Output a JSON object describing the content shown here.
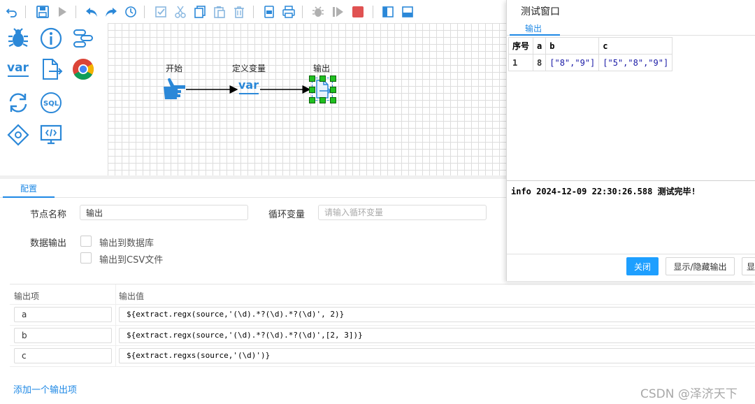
{
  "toolbar": {
    "icons": [
      "undo-icon",
      "save-icon",
      "run-icon",
      "back-icon",
      "forward-icon",
      "history-icon",
      "check-icon",
      "cut-icon",
      "copy-icon",
      "paste-icon",
      "delete-icon",
      "export-icon",
      "print-icon",
      "debug-icon",
      "step-icon",
      "stop-icon",
      "layout-left-icon",
      "layout-bottom-icon"
    ],
    "colors": {
      "icon": "#2b88d8",
      "disabled": "#b0b0b0",
      "stop": "#e05252"
    }
  },
  "palette": {
    "items": [
      "bug-icon",
      "info-icon",
      "flow-icon",
      "var-icon",
      "export-file-icon",
      "chrome-icon",
      "loop-icon",
      "sql-icon",
      "diamond-icon",
      "code-monitor-icon"
    ],
    "var_text": "var",
    "sql_text": "SQL"
  },
  "flow": {
    "nodes": [
      {
        "label": "开始",
        "icon": "pointing-hand-icon"
      },
      {
        "label": "定义变量",
        "icon": "var-icon",
        "text": "var"
      },
      {
        "label": "输出",
        "icon": "output-file-icon"
      }
    ]
  },
  "config": {
    "tab_label": "配置",
    "node_name_label": "节点名称",
    "node_name_value": "输出",
    "loop_var_label": "循环变量",
    "loop_var_placeholder": "请输入循环变量",
    "data_output_label": "数据输出",
    "option_db": "输出到数据库",
    "option_csv": "输出到CSV文件"
  },
  "output_table": {
    "headers": [
      "输出项",
      "输出值"
    ],
    "rows": [
      {
        "item": "a",
        "value": "${extract.regx(source,'(\\d).*?(\\d).*?(\\d)', 2)}"
      },
      {
        "item": "b",
        "value": "${extract.regx(source,'(\\d).*?(\\d).*?(\\d)',[2, 3])}"
      },
      {
        "item": "c",
        "value": "${extract.regxs(source,'(\\d)')}"
      }
    ],
    "add_link": "添加一个输出项"
  },
  "test_window": {
    "title": "测试窗口",
    "tab_label": "输出",
    "table": {
      "headers": [
        "序号",
        "a",
        "b",
        "c"
      ],
      "rows": [
        [
          "1",
          "8",
          "[\"8\",\"9\"]",
          "[\"5\",\"8\",\"9\"]"
        ]
      ]
    },
    "log": "info 2024-12-09 22:30:26.588 测试完毕!",
    "buttons": {
      "close": "关闭",
      "toggle_output": "显示/隐藏输出",
      "partial": "显"
    },
    "colors": {
      "primary": "#1e9fff"
    }
  },
  "watermark": "CSDN @泽济天下"
}
